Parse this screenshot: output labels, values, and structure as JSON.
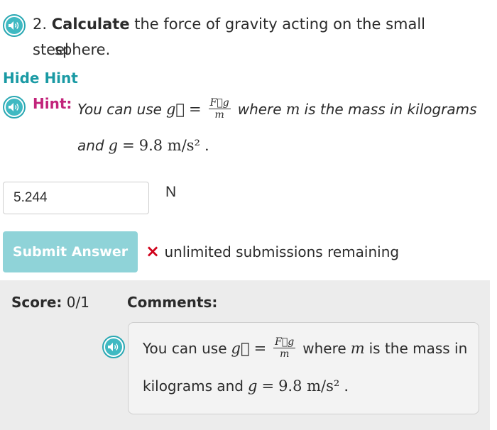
{
  "question": {
    "number": "2.",
    "bold_word": "Calculate",
    "text_line1": "the force of gravity acting on the small steel",
    "text_line2": "sphere."
  },
  "hint_toggle": "Hide Hint",
  "hint": {
    "label": "Hint:",
    "part1": "You can use",
    "part2": "where",
    "part3": "is the mass in kilograms",
    "part4": "and"
  },
  "math": {
    "g_vec": "g⃗",
    "eq": "=",
    "frac_num": "F⃗g",
    "frac_den": "m",
    "m_var": "m",
    "g_var": "g",
    "g_value": "9.8 m/s²",
    "period": "."
  },
  "answer": {
    "value": "5.244",
    "unit": "N"
  },
  "submit": {
    "label": "Submit Answer",
    "status_icon": "×",
    "status_text": "unlimited submissions remaining"
  },
  "score": {
    "label": "Score:",
    "value": "0/1",
    "comments_label": "Comments:"
  },
  "comment": {
    "part1": "You can use",
    "part2": "where",
    "part3": "is the mass in",
    "part4": "kilograms and"
  },
  "colors": {
    "teal": "#1a9aa4",
    "magenta": "#c2247b",
    "error_red": "#d0021b",
    "button_disabled": "#8fd3d8"
  },
  "icons": [
    "speaker-icon"
  ]
}
